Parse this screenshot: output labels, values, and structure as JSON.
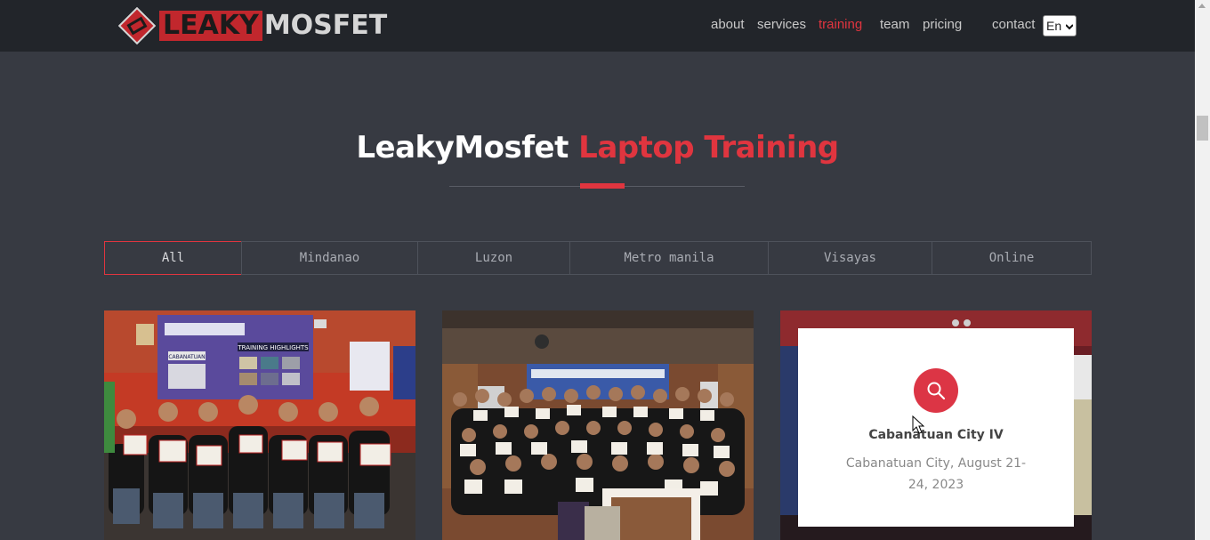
{
  "brand": {
    "part1": "LEAKY",
    "part2": "MOSFET"
  },
  "nav": {
    "items": [
      {
        "label": "about",
        "active": false
      },
      {
        "label": "services",
        "active": false
      },
      {
        "label": "training",
        "active": true
      },
      {
        "label": "team",
        "active": false
      },
      {
        "label": "pricing",
        "active": false
      },
      {
        "label": "contact",
        "active": false
      }
    ],
    "language": "En"
  },
  "section": {
    "title_main": "LeakyMosfet",
    "title_accent": "Laptop Training"
  },
  "filters": [
    {
      "label": "All",
      "active": true
    },
    {
      "label": "Mindanao",
      "active": false
    },
    {
      "label": "Luzon",
      "active": false
    },
    {
      "label": "Metro manila",
      "active": false
    },
    {
      "label": "Visayas",
      "active": false
    },
    {
      "label": "Online",
      "active": false
    }
  ],
  "gallery": {
    "hover_card": {
      "title": "Cabanatuan City IV",
      "subtitle": "Cabanatuan City, August 21-24, 2023",
      "icon": "search-icon"
    },
    "banner_text": "TRAINING HIGHLIGHTS",
    "banner_location": "CABANATUAN"
  },
  "colors": {
    "accent": "#e0353f",
    "header": "#22252a",
    "page": "#373a42"
  }
}
